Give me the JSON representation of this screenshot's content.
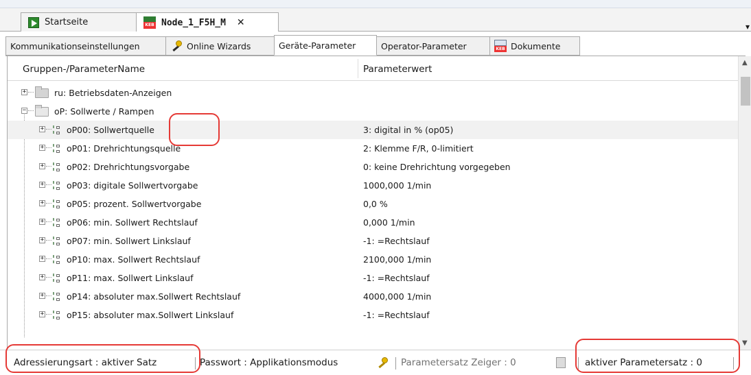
{
  "doc_tabs": [
    {
      "label": "Startseite",
      "icon": "start-arrow-icon"
    },
    {
      "label": "Node_1_F5H_M",
      "icon": "keb-device-icon",
      "close": "✕"
    }
  ],
  "prop_tabs": [
    {
      "label": "Kommunikationseinstellungen"
    },
    {
      "label": "Online Wizards",
      "icon": "wizard-key-icon"
    },
    {
      "label": "Geräte-Parameter",
      "active": true
    },
    {
      "label": "Operator-Parameter"
    },
    {
      "label": "Dokumente",
      "icon": "keb-manual-icon"
    }
  ],
  "table": {
    "col_name": "Gruppen-/ParameterName",
    "col_value": "Parameterwert",
    "groups": [
      {
        "label": "ru: Betriebsdaten-Anzeigen",
        "expanded": false
      },
      {
        "label": "oP: Sollwerte / Rampen",
        "expanded": true
      }
    ],
    "params": [
      {
        "name": "oP00: Sollwertquelle",
        "value": "3: digital in % (op05)",
        "selected": true
      },
      {
        "name": "oP01: Drehrichtungsquelle",
        "value": "2: Klemme F/R, 0-limitiert"
      },
      {
        "name": "oP02: Drehrichtungsvorgabe",
        "value": "0: keine Drehrichtung vorgegeben"
      },
      {
        "name": "oP03: digitale Sollwertvorgabe",
        "value": "1000,000 1/min"
      },
      {
        "name": "oP05: prozent. Sollwertvorgabe",
        "value": "0,0 %"
      },
      {
        "name": "oP06: min. Sollwert Rechtslauf",
        "value": "0,000 1/min"
      },
      {
        "name": "oP07: min. Sollwert Linkslauf",
        "value": "-1: =Rechtslauf"
      },
      {
        "name": "oP10: max. Sollwert Rechtslauf",
        "value": "2100,000 1/min"
      },
      {
        "name": "oP11: max. Sollwert Linkslauf",
        "value": "-1: =Rechtslauf"
      },
      {
        "name": "oP14: absoluter max.Sollwert Rechtslauf",
        "value": "4000,000 1/min"
      },
      {
        "name": "oP15: absoluter max.Sollwert Linkslauf",
        "value": "-1: =Rechtslauf"
      }
    ]
  },
  "status": {
    "adressierung": "Adressierungsart  : aktiver Satz",
    "passwort": "Passwort : Applikationsmodus",
    "zeiger": "Parametersatz Zeiger   : 0",
    "aktiver": "aktiver Parametersatz   : 0"
  },
  "colors": {
    "annotation": "#e53935",
    "selected_row": "#f1f1f1",
    "tab_border": "#a9a9a9"
  }
}
